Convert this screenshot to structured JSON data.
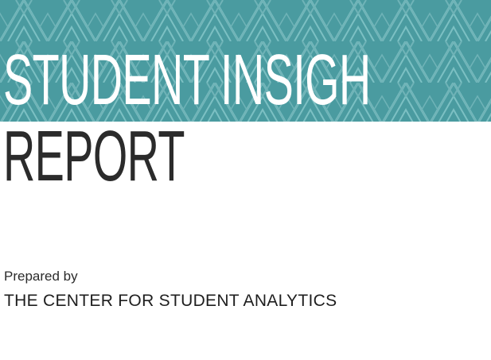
{
  "banner": {
    "color": "#4a9ba0",
    "pattern_color": "#7cc0c3"
  },
  "title": {
    "line1": "STUDENT INSIGH",
    "line2": "REPORT"
  },
  "prepared": {
    "label": "Prepared by",
    "organization": "THE CENTER FOR STUDENT ANALYTICS"
  },
  "icons": {
    "banner_pattern": "geometric-triangle-pattern"
  }
}
